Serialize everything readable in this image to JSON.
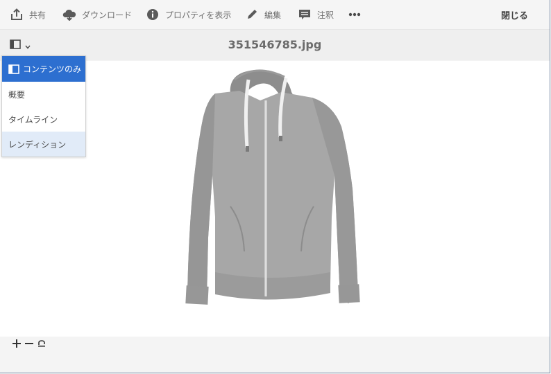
{
  "toolbar": {
    "share_label": "共有",
    "download_label": "ダウンロード",
    "properties_label": "プロパティを表示",
    "edit_label": "編集",
    "annotate_label": "注釈",
    "more_icon": "more-icon",
    "close_label": "閉じる"
  },
  "titlebar": {
    "filename": "351546785.jpg"
  },
  "rail_menu": {
    "items": [
      {
        "label": "コンテンツのみ",
        "state": "selected"
      },
      {
        "label": "概要"
      },
      {
        "label": "タイムライン"
      },
      {
        "label": "レンディション",
        "state": "hover"
      }
    ]
  },
  "zoom": {
    "zoom_in_icon": "plus-icon",
    "zoom_out_icon": "minus-icon",
    "reset_icon": "reset-zoom-icon"
  },
  "colors": {
    "accent": "#2d6fd0",
    "hover": "#e1ebf8",
    "toolbar_bg": "#f5f5f5"
  }
}
